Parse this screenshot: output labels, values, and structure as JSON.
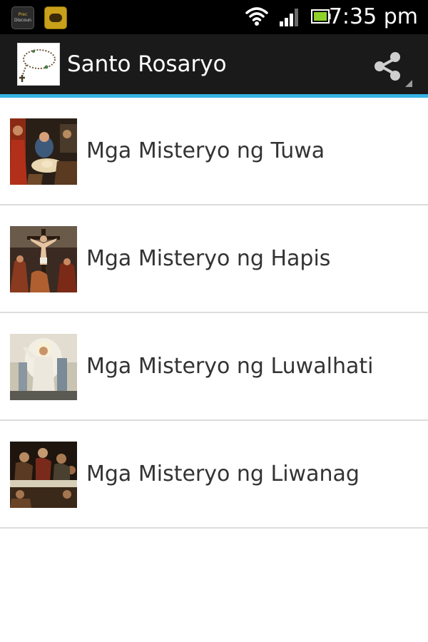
{
  "status_bar": {
    "time": "7:35 pm",
    "notification_icons": [
      "developer-app-icon",
      "game-app-icon"
    ],
    "dev_icon_text_line1": "Prec",
    "dev_icon_text_line2": "Discoun"
  },
  "action_bar": {
    "title": "Santo Rosaryo",
    "app_icon": "rosary-icon",
    "share_icon": "share-icon",
    "accent_color": "#33b5e5"
  },
  "mysteries": [
    {
      "label": "Mga Misteryo ng Tuwa",
      "thumbnail": "nativity-painting"
    },
    {
      "label": "Mga Misteryo ng Hapis",
      "thumbnail": "crucifixion-painting"
    },
    {
      "label": "Mga Misteryo ng Luwalhati",
      "thumbnail": "resurrection-painting"
    },
    {
      "label": "Mga Misteryo ng Liwanag",
      "thumbnail": "last-supper-painting"
    }
  ]
}
